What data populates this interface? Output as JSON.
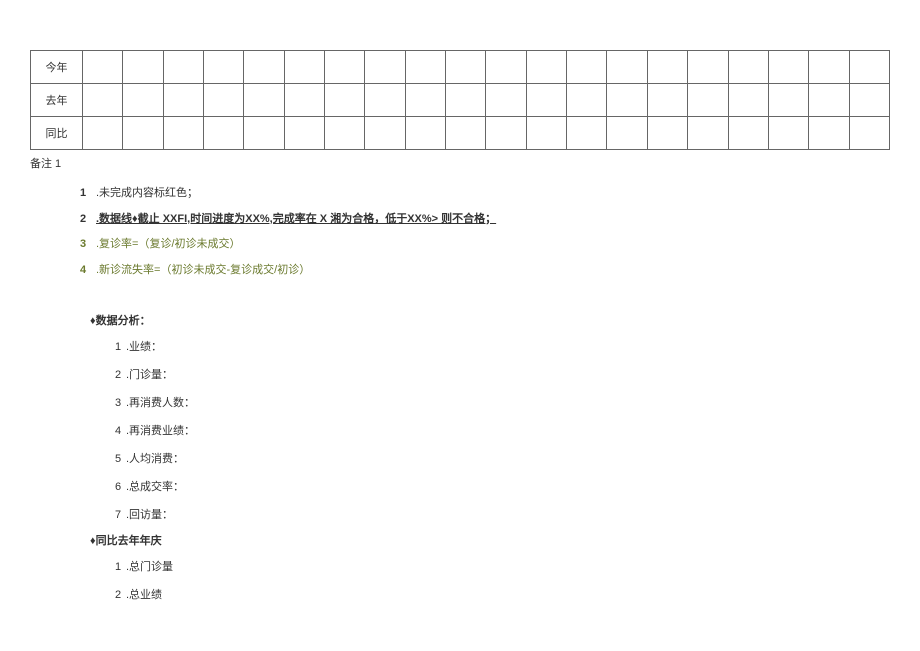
{
  "table": {
    "rows": [
      {
        "label": "今年"
      },
      {
        "label": "去年"
      },
      {
        "label": "同比"
      }
    ],
    "columns_count": 20
  },
  "notes": {
    "title": "备注 1",
    "items": [
      {
        "num": "1",
        "text": ".未完成内容标红色；",
        "class": "note-1",
        "style": "plain"
      },
      {
        "num": "2",
        "text": ".数据线♦截止 XXFI,时间进度为XX%,完成率在 X 湘为合格，低于XX%> 则不合格；",
        "class": "note-2",
        "style": "underline-bold"
      },
      {
        "num": "3",
        "text": ".复诊率=（复诊/初诊未成交）",
        "class": "note-3",
        "style": "plain"
      },
      {
        "num": "4",
        "text": ".新诊流失率=（初诊未成交-复诊成交/初诊）",
        "class": "note-4",
        "style": "plain"
      }
    ]
  },
  "analysis": {
    "section1": {
      "header": "♦数据分析：",
      "items": [
        {
          "num": "1",
          "text": ".业绩："
        },
        {
          "num": "2",
          "text": ".门诊量："
        },
        {
          "num": "3",
          "text": ".再消费人数："
        },
        {
          "num": "4",
          "text": ".再消费业绩："
        },
        {
          "num": "5",
          "text": ".人均消费："
        },
        {
          "num": "6",
          "text": ".总成交率："
        },
        {
          "num": "7",
          "text": ".回访量："
        }
      ]
    },
    "section2": {
      "header": "♦同比去年年庆",
      "items": [
        {
          "num": "1",
          "text": ".总门诊量"
        },
        {
          "num": "2",
          "text": ".总业绩"
        }
      ]
    }
  }
}
